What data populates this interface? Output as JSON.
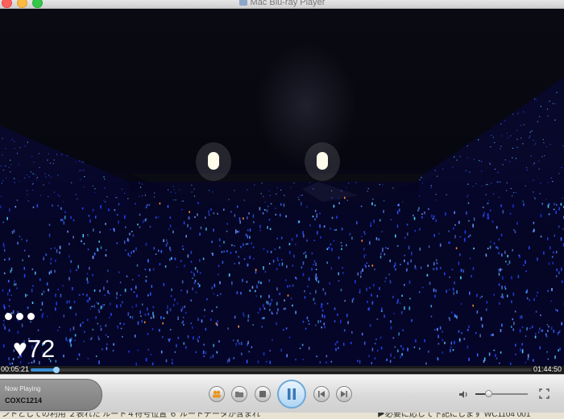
{
  "window": {
    "title": "Mac Blu-ray Player"
  },
  "overlay": {
    "likes_count": "72",
    "heart_icon": "heart-icon",
    "more_icon": "more-dots-icon"
  },
  "playback": {
    "current_time": "00:05:21",
    "total_time": "01:44:50",
    "progress": 0.051
  },
  "now_playing": {
    "label": "Now Playing",
    "title": "COXC1214"
  },
  "volume": {
    "level": 0.24
  },
  "colors": {
    "accent": "#3b8fd6",
    "play_button": "#6da8d8",
    "crowd_glow": "#2a4cff"
  },
  "bottom_strip": {
    "left_text": "ントとしての利用 ２表れた ルート４符号位置 ６ ルートデータが含まれ",
    "right_text": "▶必要に応じて下記にします WC1104 001"
  }
}
